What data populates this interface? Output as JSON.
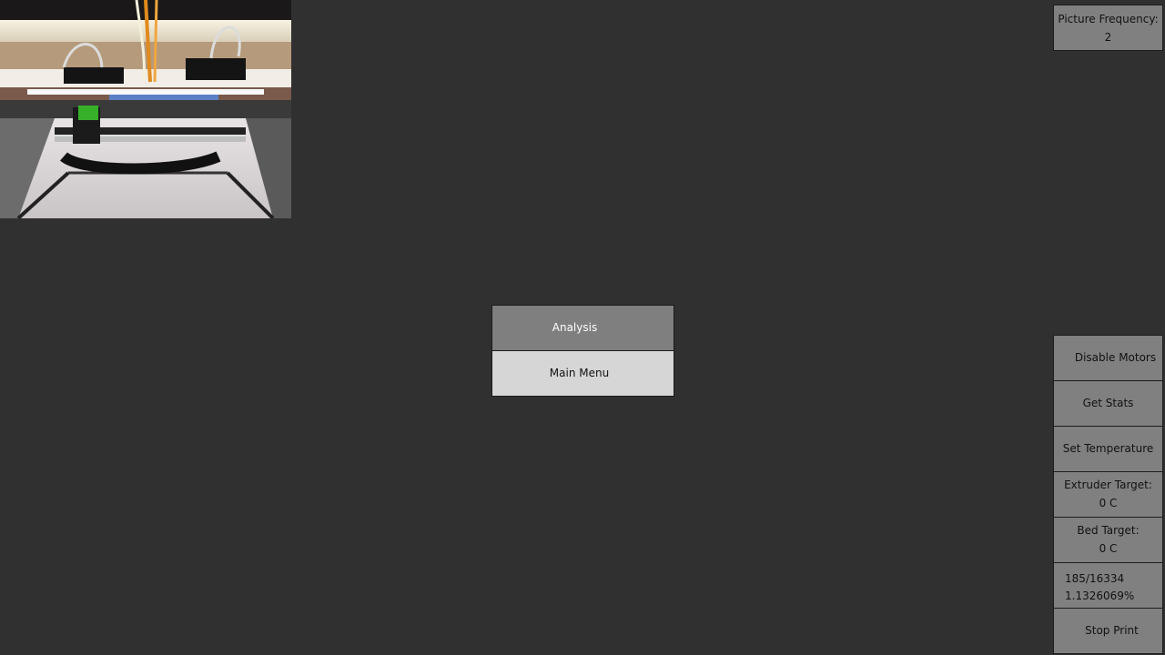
{
  "camera": {
    "description_icon": "camera-feed-image"
  },
  "picture_frequency": {
    "label": "Picture Frequency:",
    "value": "2"
  },
  "center_menu": {
    "analysis_label": "Analysis",
    "main_menu_label": "Main Menu"
  },
  "controls": {
    "disable_motors": "Disable Motors",
    "get_stats": "Get Stats",
    "set_temperature": "Set Temperature",
    "extruder_target_label": "Extruder Target:",
    "extruder_target_value": "0 C",
    "bed_target_label": "Bed Target:",
    "bed_target_value": "0 C",
    "progress_count": "185/16334",
    "progress_percent": "1.1326069%",
    "stop_print": "Stop Print"
  },
  "colors": {
    "background": "#303030",
    "button_gray": "#808080",
    "button_light": "#d6d6d6"
  }
}
